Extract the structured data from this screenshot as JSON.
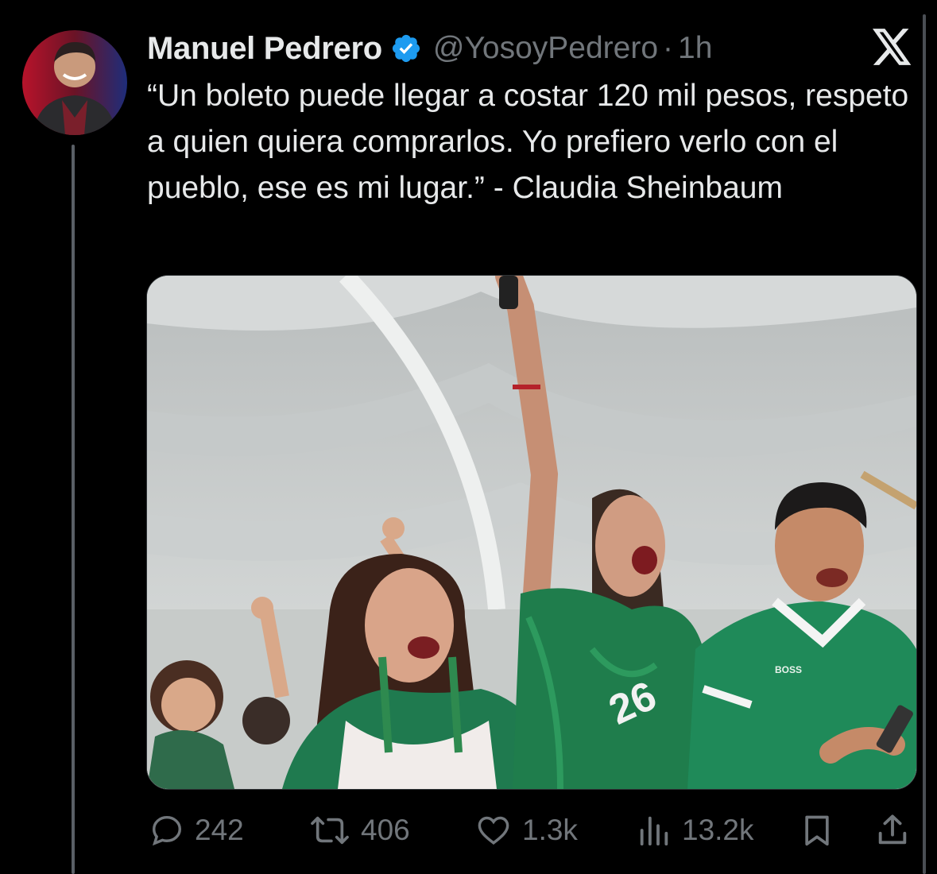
{
  "author": {
    "name": "Manuel Pedrero",
    "handle": "@YosoyPedrero",
    "separator": "·",
    "time": "1h",
    "verified": true,
    "verified_color": "#1d9bf0"
  },
  "platform_logo": "x-logo",
  "tweet": {
    "text": "“Un boleto puede llegar a costar 120 mil pesos, respeto a quien quiera comprarlos. Yo prefiero verlo con el pueblo, ese es mi lugar.” - Claudia Sheinbaum"
  },
  "media": {
    "type": "photo",
    "jersey_number": "26",
    "shirt_brand": "BOSS"
  },
  "actions": {
    "replies": {
      "icon": "reply-icon",
      "count": "242"
    },
    "reposts": {
      "icon": "repost-icon",
      "count": "406"
    },
    "likes": {
      "icon": "heart-icon",
      "count": "1.3k"
    },
    "views": {
      "icon": "views-icon",
      "count": "13.2k"
    },
    "bookmark": {
      "icon": "bookmark-icon"
    },
    "share": {
      "icon": "share-icon"
    }
  },
  "colors": {
    "background": "#000000",
    "text_primary": "#e7e9ea",
    "text_secondary": "#71767b",
    "accent": "#1d9bf0"
  }
}
